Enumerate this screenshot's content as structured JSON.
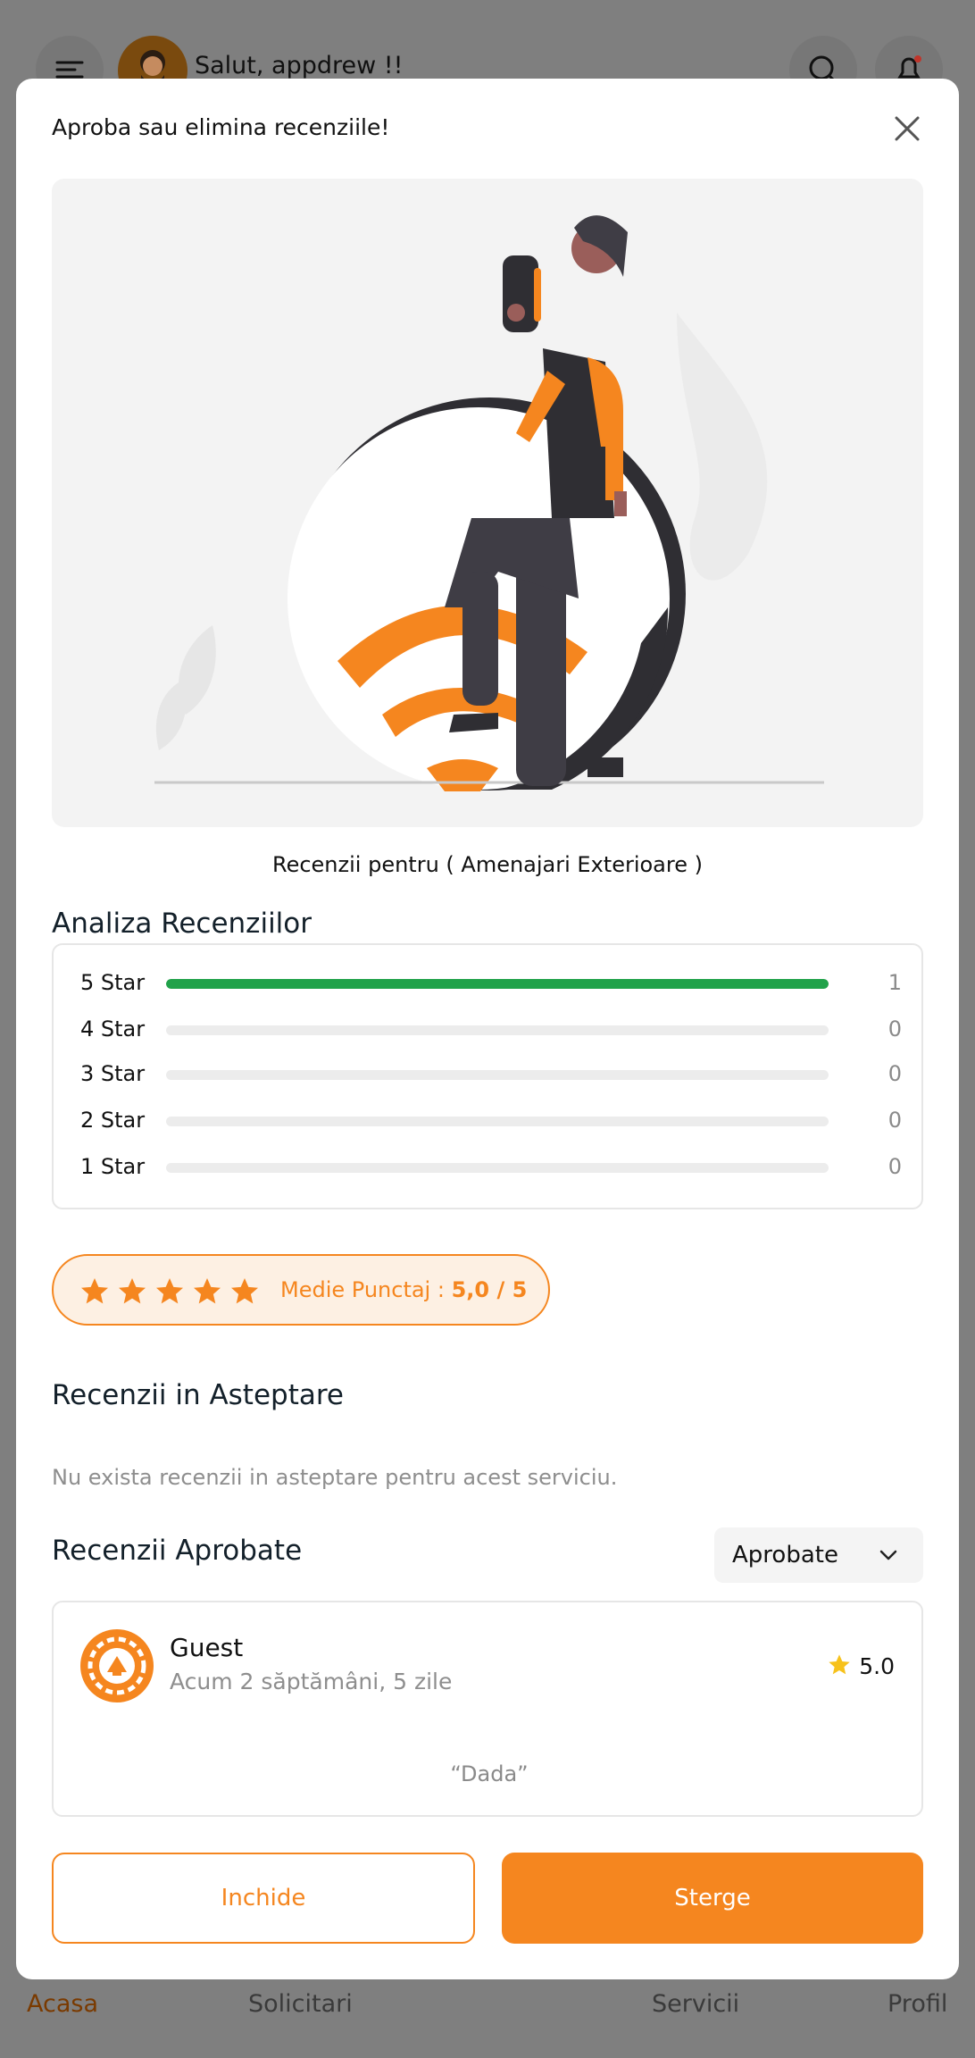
{
  "background": {
    "greeting": "Salut, appdrew !!",
    "nav": {
      "home": "Acasa",
      "requests": "Solicitari",
      "services": "Servicii",
      "profile": "Profil"
    }
  },
  "modal": {
    "title": "Aproba sau elimina recenziile!",
    "subtitle": "Recenzii pentru ( Amenajari Exterioare )",
    "analysis_title": "Analiza Recenziilor",
    "breakdown": [
      {
        "label": "5 Star",
        "count": "1",
        "fraction": 1.0
      },
      {
        "label": "4 Star",
        "count": "0",
        "fraction": 0
      },
      {
        "label": "3 Star",
        "count": "0",
        "fraction": 0
      },
      {
        "label": "2 Star",
        "count": "0",
        "fraction": 0
      },
      {
        "label": "1 Star",
        "count": "0",
        "fraction": 0
      }
    ],
    "average": {
      "label": "Medie Punctaj : ",
      "value": "5,0 / 5",
      "stars": 5
    },
    "pending_title": "Recenzii in Asteptare",
    "pending_empty": "Nu exista recenzii in asteptare pentru acest serviciu.",
    "approved_title": "Recenzii Aprobate",
    "filter": {
      "selected": "Aprobate"
    },
    "reviews": [
      {
        "name": "Guest",
        "date": "Acum 2 săptămâni, 5 zile",
        "rating": "5.0",
        "text": "“Dada”"
      }
    ],
    "buttons": {
      "close": "Inchide",
      "delete": "Sterge"
    }
  },
  "colors": {
    "accent": "#f5861f",
    "bar_fill": "#21a24a",
    "star_yellow": "#f7c21c"
  }
}
